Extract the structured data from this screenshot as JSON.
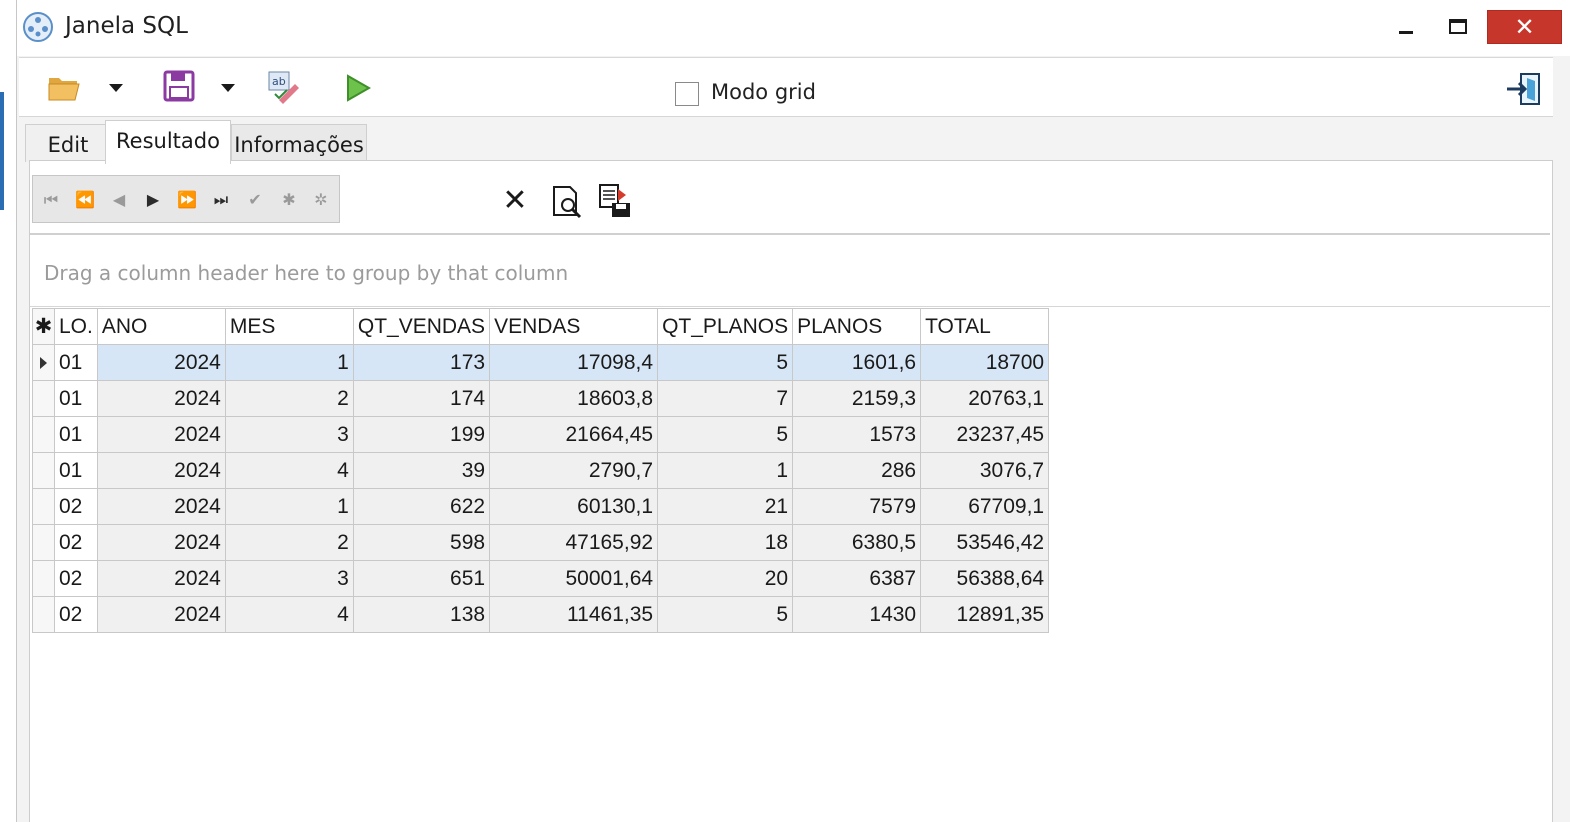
{
  "window": {
    "title": "Janela SQL",
    "close_glyph": "✕"
  },
  "toolbar": {
    "icons": [
      "folder-open-icon",
      "save-icon",
      "spellcheck-icon",
      "run-icon",
      "exit-icon"
    ],
    "modo_grid_label": "Modo grid",
    "modo_grid_checked": false
  },
  "tabs": [
    {
      "label": "Edit"
    },
    {
      "label": "Resultado",
      "active": true
    },
    {
      "label": "Informações"
    }
  ],
  "navigator": {
    "buttons": [
      "⏮",
      "⏪",
      "◀",
      "▶",
      "⏩",
      "⏭",
      "✔",
      "✱",
      "✲"
    ]
  },
  "grid_tools": {
    "icons": [
      "delete-x-icon",
      "print-preview-icon",
      "export-icon"
    ],
    "delete_glyph": "✕"
  },
  "groupby": {
    "hint": "Drag a column header here to group by that column"
  },
  "grid": {
    "corner": "✱",
    "columns": [
      "LO.",
      "ANO",
      "MES",
      "QT_VENDAS",
      "VENDAS",
      "QT_PLANOS",
      "PLANOS",
      "TOTAL"
    ],
    "rows": [
      [
        "01",
        "2024",
        "1",
        "173",
        "17098,4",
        "5",
        "1601,6",
        "18700"
      ],
      [
        "01",
        "2024",
        "2",
        "174",
        "18603,8",
        "7",
        "2159,3",
        "20763,1"
      ],
      [
        "01",
        "2024",
        "3",
        "199",
        "21664,45",
        "5",
        "1573",
        "23237,45"
      ],
      [
        "01",
        "2024",
        "4",
        "39",
        "2790,7",
        "1",
        "286",
        "3076,7"
      ],
      [
        "02",
        "2024",
        "1",
        "622",
        "60130,1",
        "21",
        "7579",
        "67709,1"
      ],
      [
        "02",
        "2024",
        "2",
        "598",
        "47165,92",
        "18",
        "6380,5",
        "53546,42"
      ],
      [
        "02",
        "2024",
        "3",
        "651",
        "50001,64",
        "20",
        "6387",
        "56388,64"
      ],
      [
        "02",
        "2024",
        "4",
        "138",
        "11461,35",
        "5",
        "1430",
        "12891,35"
      ]
    ],
    "selected_row": 0
  },
  "colors": {
    "accent": "#2a6db3",
    "close_button": "#c7362b",
    "selection": "#d7e6f6",
    "run_green": "#6cc24a",
    "save_purple": "#8a3aa0"
  }
}
